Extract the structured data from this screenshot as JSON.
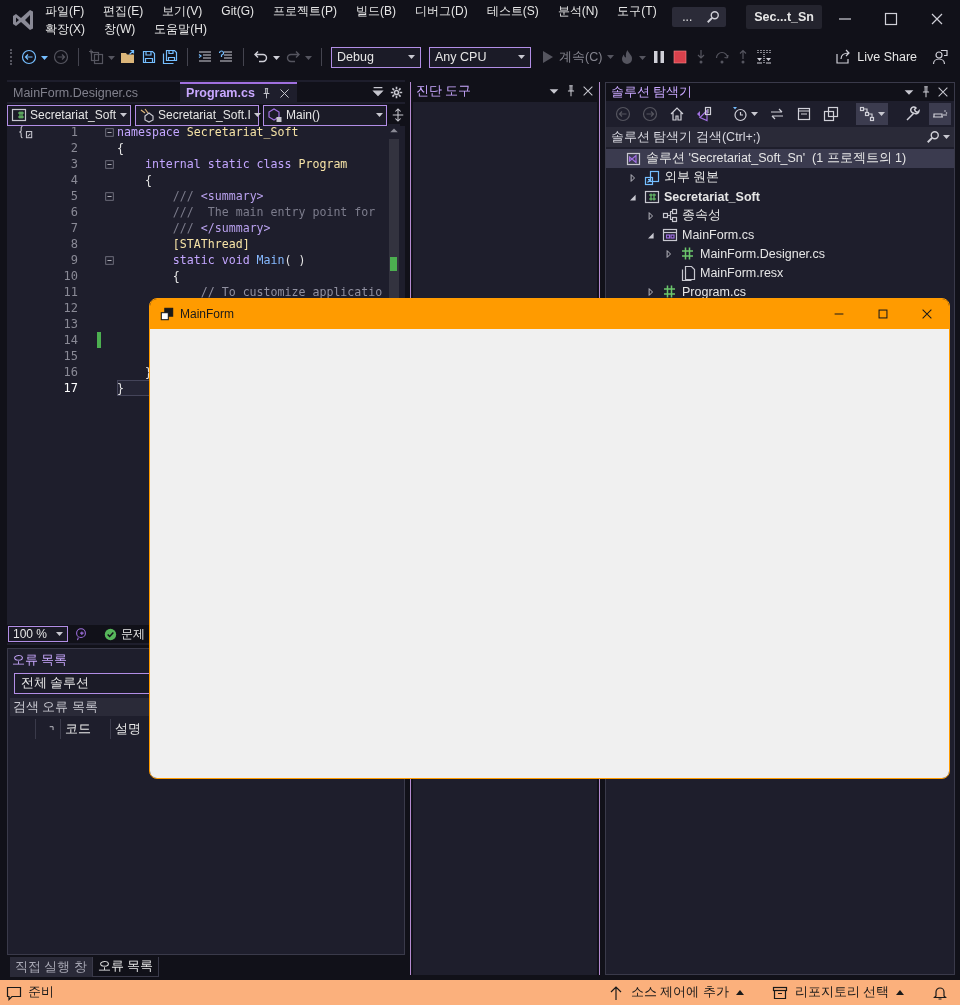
{
  "title_bar": {
    "menu_rows": [
      [
        "파일(F)",
        "편집(E)",
        "보기(V)",
        "Git(G)",
        "프로젝트(P)",
        "빌드(B)",
        "디버그(D)",
        "테스트(S)",
        "분석(N)",
        "도구(T)"
      ],
      [
        "확장(X)",
        "창(W)",
        "도움말(H)"
      ]
    ],
    "search": "...",
    "solution_name": "Sec...t_Sn"
  },
  "toolbar": {
    "items": [
      {
        "kind": "back",
        "disabled": false,
        "menu": true
      },
      {
        "kind": "forward",
        "disabled": true,
        "menu": false
      },
      {
        "kind": "separator"
      },
      {
        "kind": "new_project",
        "disabled": true,
        "menu": true
      },
      {
        "kind": "open",
        "disabled": false,
        "menu": false
      },
      {
        "kind": "save",
        "disabled": false,
        "menu": false
      },
      {
        "kind": "save_all",
        "disabled": false,
        "menu": false
      },
      {
        "kind": "separator"
      },
      {
        "kind": "comment",
        "disabled": false,
        "menu": false
      },
      {
        "kind": "uncomment",
        "disabled": false,
        "menu": false
      },
      {
        "kind": "separator"
      },
      {
        "kind": "undo",
        "disabled": false,
        "menu": true
      },
      {
        "kind": "redo",
        "disabled": true,
        "menu": true
      },
      {
        "kind": "separator"
      },
      {
        "kind": "combo",
        "value": "Debug"
      },
      {
        "kind": "combo",
        "value": "Any CPU"
      },
      {
        "kind": "continue",
        "label": "계속(C)",
        "disabled": true,
        "menu": true
      },
      {
        "kind": "hot_reload",
        "disabled": true,
        "menu": true
      },
      {
        "kind": "pause",
        "disabled": false,
        "menu": false
      },
      {
        "kind": "stop",
        "disabled": false,
        "menu": false
      },
      {
        "kind": "step_into",
        "disabled": true,
        "menu": false
      },
      {
        "kind": "step_over",
        "disabled": true,
        "menu": false
      },
      {
        "kind": "step_out",
        "disabled": true,
        "menu": false
      },
      {
        "kind": "threads",
        "disabled": false,
        "menu": false
      }
    ],
    "live_share": "Live Share"
  },
  "editor": {
    "tabs": [
      {
        "label": "MainForm.Designer.cs",
        "selected": false
      },
      {
        "label": "Program.cs",
        "selected": true
      }
    ],
    "navigation": [
      {
        "kind": "project",
        "value": "Secretariat_Soft"
      },
      {
        "kind": "class",
        "value": "Secretariat_Soft.I"
      },
      {
        "kind": "member",
        "value": "Main()"
      }
    ],
    "lines": [
      {
        "number": "1",
        "fold": true,
        "modified": false,
        "current": false,
        "tokens": [
          {
            "text": "namespace ",
            "kind": "keyword"
          },
          {
            "text": "Secretariat_Soft",
            "kind": "type"
          }
        ]
      },
      {
        "number": "2",
        "fold": false,
        "modified": false,
        "current": false,
        "tokens": [
          {
            "text": "{",
            "kind": "plain"
          }
        ]
      },
      {
        "number": "3",
        "fold": true,
        "modified": false,
        "current": false,
        "tokens": [
          {
            "text": "    internal static class ",
            "kind": "keyword"
          },
          {
            "text": "Program",
            "kind": "type"
          }
        ]
      },
      {
        "number": "4",
        "fold": false,
        "modified": false,
        "current": false,
        "tokens": [
          {
            "text": "    {",
            "kind": "plain"
          }
        ]
      },
      {
        "number": "5",
        "fold": true,
        "modified": false,
        "current": false,
        "tokens": [
          {
            "text": "        /// ",
            "kind": "doc"
          },
          {
            "text": "<summary>",
            "kind": "doctag"
          }
        ]
      },
      {
        "number": "6",
        "fold": false,
        "modified": false,
        "current": false,
        "tokens": [
          {
            "text": "        ///  The main entry point for",
            "kind": "doc"
          }
        ]
      },
      {
        "number": "7",
        "fold": false,
        "modified": false,
        "current": false,
        "tokens": [
          {
            "text": "        /// ",
            "kind": "doc"
          },
          {
            "text": "</summary>",
            "kind": "doctag"
          }
        ]
      },
      {
        "number": "8",
        "fold": false,
        "modified": false,
        "current": false,
        "tokens": [
          {
            "text": "        [STAThread]",
            "kind": "type"
          }
        ]
      },
      {
        "number": "9",
        "fold": true,
        "modified": false,
        "current": false,
        "tokens": [
          {
            "text": "        static void ",
            "kind": "keyword"
          },
          {
            "text": "Main",
            "kind": "method"
          },
          {
            "text": "( )",
            "kind": "plain"
          }
        ]
      },
      {
        "number": "10",
        "fold": false,
        "modified": false,
        "current": false,
        "tokens": [
          {
            "text": "        {",
            "kind": "plain"
          }
        ]
      },
      {
        "number": "11",
        "fold": false,
        "modified": false,
        "current": false,
        "tokens": [
          {
            "text": "            // To customize applicatio",
            "kind": "comment"
          }
        ]
      },
      {
        "number": "12",
        "fold": false,
        "modified": false,
        "current": false
      },
      {
        "number": "13",
        "fold": false,
        "modified": false,
        "current": false
      },
      {
        "number": "14",
        "fold": false,
        "modified": true,
        "current": false
      },
      {
        "number": "15",
        "fold": false,
        "modified": false,
        "current": false
      },
      {
        "number": "16",
        "fold": false,
        "modified": false,
        "current": false,
        "tokens": [
          {
            "text": "    }",
            "kind": "plain"
          }
        ]
      },
      {
        "number": "17",
        "fold": false,
        "modified": false,
        "current": true,
        "tokens": [
          {
            "text": "}",
            "kind": "plain"
          }
        ]
      }
    ],
    "zoom": "100 %",
    "health": "문제"
  },
  "error_list": {
    "title": "오류 목록",
    "scope": "전체 솔루션",
    "search_placeholder": "검색 오류 목록",
    "columns": [
      "코드",
      "설명"
    ],
    "bottom_tabs": [
      {
        "label": "직접 실행 창",
        "selected": false
      },
      {
        "label": "오류 목록",
        "selected": true
      }
    ]
  },
  "diagnostics": {
    "title": "진단 도구"
  },
  "solution_explorer": {
    "title": "솔루션 탐색기",
    "toolbar": [
      {
        "kind": "back",
        "disabled": true,
        "pressed": false,
        "menu": false
      },
      {
        "kind": "forward",
        "disabled": true,
        "pressed": false,
        "menu": false
      },
      {
        "kind": "home",
        "disabled": false,
        "pressed": false,
        "menu": false
      },
      {
        "kind": "vs_switch",
        "disabled": false,
        "pressed": false,
        "menu": false
      },
      {
        "kind": "separator"
      },
      {
        "kind": "clock",
        "disabled": false,
        "pressed": false,
        "menu": true
      },
      {
        "kind": "sync",
        "disabled": false,
        "pressed": false,
        "menu": false
      },
      {
        "kind": "collapse",
        "disabled": false,
        "pressed": false,
        "menu": false
      },
      {
        "kind": "show_all",
        "disabled": false,
        "pressed": false,
        "menu": false
      },
      {
        "kind": "separator"
      },
      {
        "kind": "tree_view",
        "disabled": false,
        "pressed": true,
        "menu": true
      },
      {
        "kind": "separator"
      },
      {
        "kind": "wrench",
        "disabled": false,
        "pressed": false,
        "menu": false
      },
      {
        "kind": "preview",
        "disabled": false,
        "pressed": true,
        "menu": false
      }
    ],
    "search_placeholder": "솔루션 탐색기 검색(Ctrl+;)",
    "tree": [
      {
        "label": "솔루션 'Secretariat_Soft_Sn'  (1 프로젝트의 1)",
        "kind": "solution",
        "selected": true,
        "children": [
          {
            "label": "외부 원본",
            "kind": "external",
            "selected": false,
            "expanded": false
          },
          {
            "label": "Secretariat_Soft",
            "kind": "project",
            "selected": false,
            "expanded": true,
            "children": [
              {
                "label": "종속성",
                "kind": "dependencies",
                "selected": false,
                "expanded": false
              },
              {
                "label": "MainForm.cs",
                "kind": "form",
                "selected": false,
                "expanded": true,
                "children": [
                  {
                    "label": "MainForm.Designer.cs",
                    "kind": "csharp",
                    "selected": false,
                    "expanded": false
                  },
                  {
                    "label": "MainForm.resx",
                    "kind": "resx",
                    "selected": false
                  }
                ]
              },
              {
                "label": "Program.cs",
                "kind": "csharp",
                "selected": false,
                "expanded": false
              }
            ]
          }
        ]
      }
    ]
  },
  "status_bar": {
    "status": "준비",
    "source_control": "소스 제어에 추가",
    "repository": "리포지토리 선택"
  },
  "form_window": {
    "title": "MainForm"
  }
}
